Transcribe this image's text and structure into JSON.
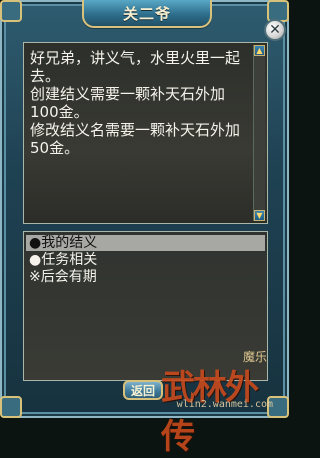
{
  "window": {
    "title": "关二爷",
    "close_icon": "close-icon"
  },
  "dialog": {
    "text": "好兄弟，讲义气，水里火里一起去。\n创建结义需要一颗补天石外加100金。\n修改结义名需要一颗补天石外加50金。",
    "scroll_up_icon": "arrow-up-icon",
    "scroll_down_icon": "arrow-down-icon"
  },
  "options": [
    {
      "label": "●我的结义",
      "selected": true
    },
    {
      "label": "●任务相关",
      "selected": false
    },
    {
      "label": "※后会有期",
      "selected": false
    }
  ],
  "footer": {
    "back_label": "返回"
  },
  "logo": {
    "main": "武林外传",
    "top": "魔乐",
    "sub": "wlin2.wanmei.com"
  }
}
